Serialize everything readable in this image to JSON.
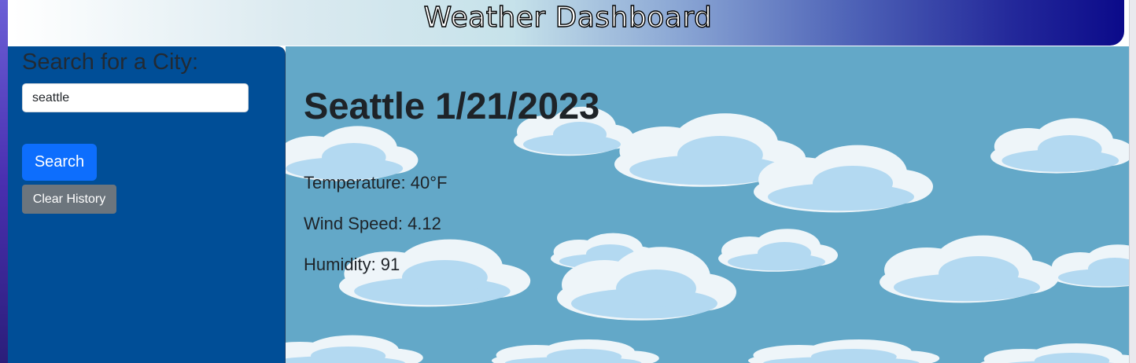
{
  "header": {
    "title": "Weather Dashboard"
  },
  "sidebar": {
    "heading": "Search for a City:",
    "search_input_value": "seattle",
    "search_button_label": "Search",
    "clear_history_label": "Clear History"
  },
  "current_weather": {
    "city_date": "Seattle 1/21/2023",
    "temperature": "Temperature: 40°F",
    "wind_speed": "Wind Speed: 4.12",
    "humidity": "Humidity: 91"
  },
  "colors": {
    "sidebar_bg": "#004e97",
    "main_bg": "#63a8c8",
    "search_button": "#0d6efd",
    "clear_button": "#6c757d",
    "header_gradient_start": "#ffffff",
    "header_gradient_end": "#0b0a8a"
  }
}
